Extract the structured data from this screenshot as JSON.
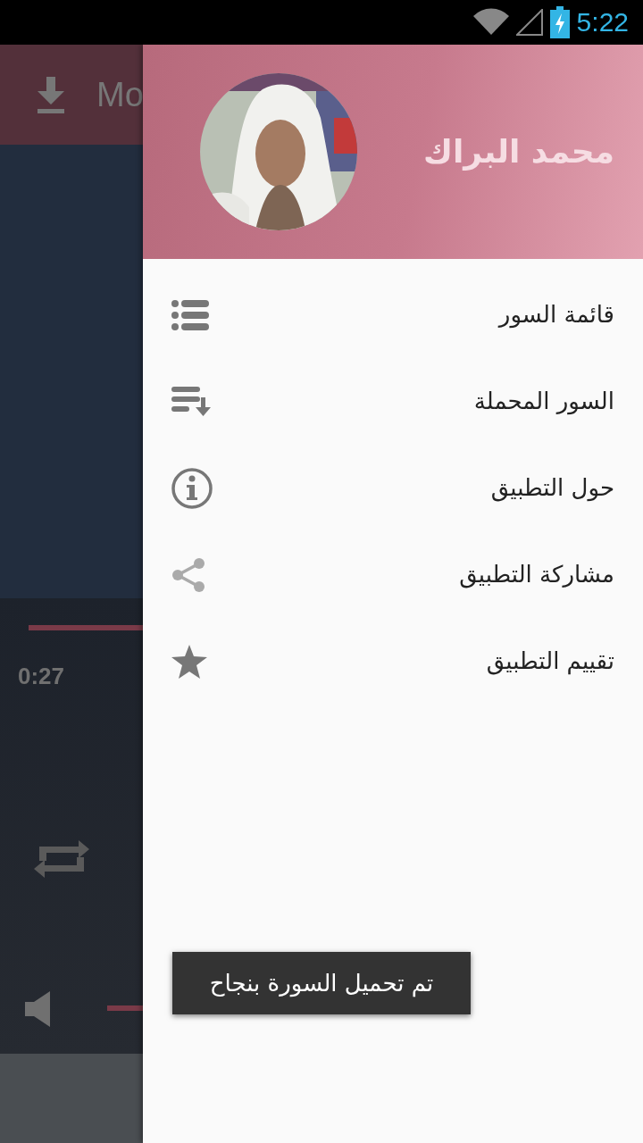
{
  "status_bar": {
    "time": "5:22"
  },
  "background_app": {
    "toolbar_title": "Mo",
    "elapsed": "0:27"
  },
  "drawer": {
    "header": {
      "name": "محمد البراك"
    },
    "items": [
      {
        "label": "قائمة السور",
        "kind": "list"
      },
      {
        "label": "السور المحملة",
        "kind": "downloads"
      },
      {
        "label": "حول التطبيق",
        "kind": "info"
      },
      {
        "label": "مشاركة التطبيق",
        "kind": "share"
      },
      {
        "label": "تقييم التطبيق",
        "kind": "star"
      }
    ]
  },
  "toast": {
    "text": "تم تحميل السورة بنجاح"
  }
}
